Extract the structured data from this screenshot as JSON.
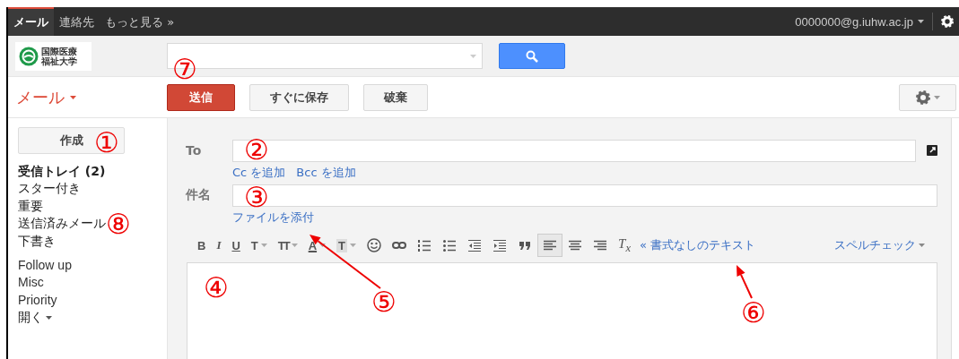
{
  "top_bar": {
    "tabs": [
      {
        "label": "メール",
        "selected": true
      },
      {
        "label": "連絡先",
        "selected": false
      },
      {
        "label": "もっと見る »",
        "selected": false
      }
    ],
    "account": "0000000@g.iuhw.ac.jp"
  },
  "header": {
    "logo": {
      "lines": [
        "国際医療",
        "福祉大学"
      ]
    }
  },
  "toolbar": {
    "app_menu": "メール",
    "buttons": [
      {
        "label": "送信",
        "kind": "primary"
      },
      {
        "label": "すぐに保存",
        "kind": "normal"
      },
      {
        "label": "破棄",
        "kind": "normal"
      }
    ]
  },
  "sidebar": {
    "compose_button": "作成",
    "folders": [
      {
        "label": "受信トレイ (2)",
        "unread": true
      },
      {
        "label": "スター付き",
        "unread": false
      },
      {
        "label": "重要",
        "unread": false
      },
      {
        "label": "送信済みメール",
        "unread": false
      },
      {
        "label": "下書き",
        "unread": false
      }
    ],
    "labels": [
      "Follow up",
      "Misc",
      "Priority"
    ],
    "more": "開く"
  },
  "compose": {
    "to_label": "To",
    "add_links": [
      "Cc を追加",
      "Bcc を追加"
    ],
    "subject_label": "件名",
    "attach_link": "ファイルを添付",
    "format_tools": [
      {
        "kind": "bold",
        "glyph": "B",
        "selected": false
      },
      {
        "kind": "italic",
        "glyph": "I",
        "selected": false
      },
      {
        "kind": "underline",
        "glyph": "U",
        "selected": false
      },
      {
        "kind": "font",
        "glyph": "T",
        "selected": false
      },
      {
        "kind": "size",
        "glyph": "TT",
        "selected": false
      },
      {
        "kind": "color",
        "glyph": "A",
        "selected": false
      },
      {
        "kind": "highlight",
        "glyph": "T",
        "selected": false
      },
      {
        "kind": "emoji",
        "selected": false
      },
      {
        "kind": "link",
        "selected": false
      },
      {
        "kind": "numbered-list",
        "selected": false
      },
      {
        "kind": "bulleted-list",
        "selected": false
      },
      {
        "kind": "indent-less",
        "selected": false
      },
      {
        "kind": "indent-more",
        "selected": false
      },
      {
        "kind": "quote",
        "selected": false
      },
      {
        "kind": "align-left",
        "selected": true
      },
      {
        "kind": "align-center",
        "selected": false
      },
      {
        "kind": "align-right",
        "selected": false
      },
      {
        "kind": "clear-format",
        "glyph": "T$_{x}$",
        "selected": false
      }
    ],
    "plain_text_link": "« 書式なしのテキスト",
    "spell_check": "スペルチェック"
  },
  "annotations": [
    {
      "label": "①",
      "arrow": false
    },
    {
      "label": "②",
      "arrow": false
    },
    {
      "label": "③",
      "arrow": false
    },
    {
      "label": "④",
      "arrow": false
    },
    {
      "label": "⑤",
      "arrow": true
    },
    {
      "label": "⑥",
      "arrow": true
    },
    {
      "label": "⑦",
      "arrow": false
    },
    {
      "label": "⑧",
      "arrow": false
    }
  ]
}
